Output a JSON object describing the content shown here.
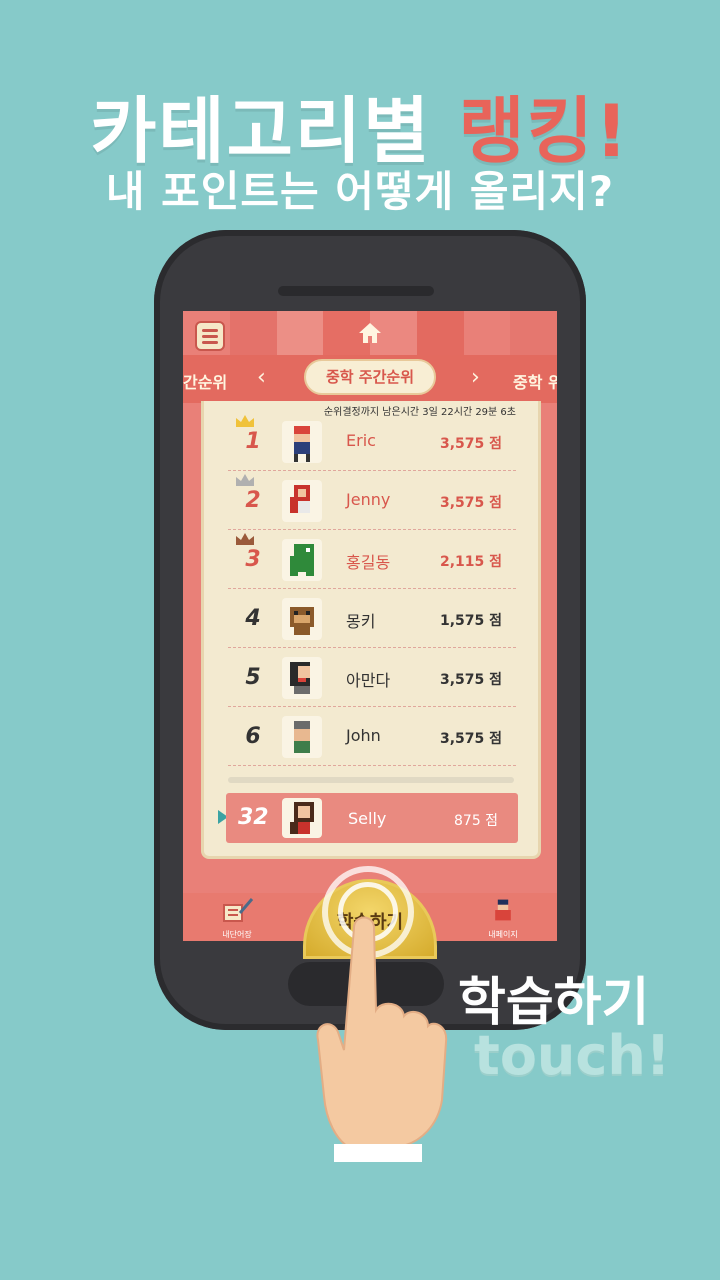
{
  "promo": {
    "headline": "카테고리별",
    "headline_accent": "랭킹!",
    "subheadline": "내 포인트는 어떻게 올리지?",
    "cta": "학습하기",
    "cta_sub": "touch!"
  },
  "app": {
    "tabs": {
      "prev_label": "간순위",
      "current_label": "중학 주간순위",
      "next_label": "중학 위"
    },
    "timer_text": "순위결정까지 남은시간 3일 22시간 29분 6초",
    "ranking": [
      {
        "rank": "1",
        "name": "Eric",
        "score": "3,575 점",
        "crown": "gold"
      },
      {
        "rank": "2",
        "name": "Jenny",
        "score": "3,575 점",
        "crown": "silver"
      },
      {
        "rank": "3",
        "name": "홍길동",
        "score": "2,115 점",
        "crown": "bronze"
      },
      {
        "rank": "4",
        "name": "몽키",
        "score": "1,575 점",
        "crown": ""
      },
      {
        "rank": "5",
        "name": "아만다",
        "score": "3,575 점",
        "crown": ""
      },
      {
        "rank": "6",
        "name": "John",
        "score": "3,575 점",
        "crown": ""
      }
    ],
    "my_rank": {
      "rank": "32",
      "name": "Selly",
      "score": "875 점"
    },
    "bottom_nav": {
      "left_label": "내단어장",
      "center_label": "학습하기",
      "right_label": "내페이지"
    }
  },
  "colors": {
    "background": "#86cac9",
    "accent": "#e8645a",
    "screen": "#e98078",
    "board": "#f3ead0",
    "gold": "#f0c23a",
    "silver": "#b0b0b0",
    "bronze": "#9a5a3a"
  },
  "icons": [
    "menu-icon",
    "home-icon",
    "chevron-left-icon",
    "chevron-right-icon",
    "crown-icon",
    "pencil-notebook-icon",
    "profile-avatar-icon",
    "hand-pointer-icon"
  ]
}
